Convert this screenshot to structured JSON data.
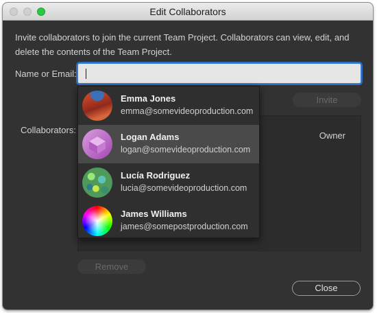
{
  "window": {
    "title": "Edit Collaborators"
  },
  "description": "Invite collaborators to join the current Team Project. Collaborators can view, edit, and delete the contents of the Team Project.",
  "name_field": {
    "label": "Name or Email:",
    "value": ""
  },
  "invite_label": "Invite",
  "collaborators": {
    "label": "Collaborators:",
    "owner_label": "Owner"
  },
  "remove_label": "Remove",
  "close_label": "Close",
  "suggestions": [
    {
      "name": "Emma Jones",
      "email": "emma@somevideoproduction.com",
      "avatar_icon": "red-rock-avatar",
      "highlighted": false
    },
    {
      "name": "Logan Adams",
      "email": "logan@somevideoproduction.com",
      "avatar_icon": "purple-shape-avatar",
      "highlighted": true
    },
    {
      "name": "Lucía Rodriguez",
      "email": "lucia@somevideoproduction.com",
      "avatar_icon": "green-mosaic-avatar",
      "highlighted": false
    },
    {
      "name": "James Williams",
      "email": "james@somepostproduction.com",
      "avatar_icon": "color-wheel-avatar",
      "highlighted": false
    }
  ],
  "colors": {
    "focus_ring": "#3d82d3",
    "dialog_bg": "#323232",
    "highlight_bg": "#4a4a4a",
    "zoom_button": "#2ac940"
  }
}
